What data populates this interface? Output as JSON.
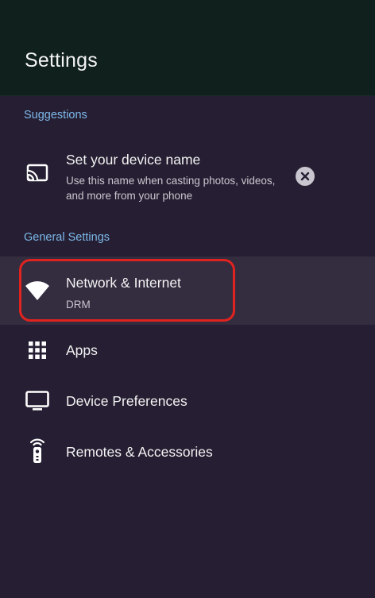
{
  "header": {
    "title": "Settings"
  },
  "suggestions": {
    "section_label": "Suggestions",
    "item": {
      "title": "Set your device name",
      "description_line1": "Use this name when casting photos, videos,",
      "description_line2": "and more from your phone",
      "icon": "cast-icon",
      "dismiss_icon": "close-circle-icon"
    }
  },
  "general": {
    "section_label": "General Settings",
    "items": [
      {
        "label": "Network & Internet",
        "sub": "DRM",
        "icon": "wifi-icon",
        "selected": true
      },
      {
        "label": "Apps",
        "icon": "apps-grid-icon"
      },
      {
        "label": "Device Preferences",
        "icon": "tv-icon"
      },
      {
        "label": "Remotes & Accessories",
        "icon": "remote-icon"
      }
    ]
  },
  "colors": {
    "accent": "#7db8ea",
    "highlight_border": "#e0231f",
    "background": "#261f33",
    "header_background": "#10201c"
  }
}
